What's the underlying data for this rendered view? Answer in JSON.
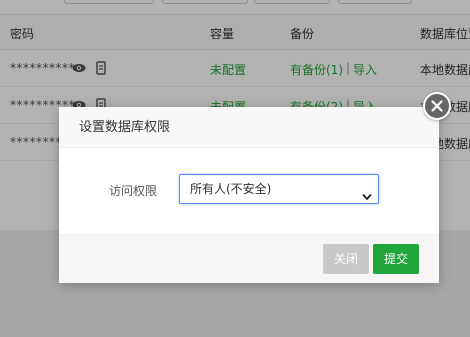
{
  "table": {
    "headers": {
      "password": "密码",
      "capacity": "容量",
      "backup": "备份",
      "location": "数据库位置"
    },
    "rows": [
      {
        "password": "**********",
        "capacity": "未配置",
        "backup": "有备份(1)",
        "import": "导入",
        "location": "本地数据库"
      },
      {
        "password": "**********",
        "capacity": "未配置",
        "backup": "有备份(2)",
        "import": "导入",
        "location": "本地数据库"
      },
      {
        "password": "**********",
        "capacity": "",
        "backup": "",
        "import": "",
        "location": "本地数据库"
      }
    ],
    "separator": "|"
  },
  "modal": {
    "title": "设置数据库权限",
    "field_label": "访问权限",
    "select_value": "所有人(不安全)",
    "close_button": "关闭",
    "submit_button": "提交"
  },
  "colors": {
    "accent_green": "#20a53a",
    "close_disabled": "#c9c9c9",
    "focus_blue": "#4d90fe"
  }
}
